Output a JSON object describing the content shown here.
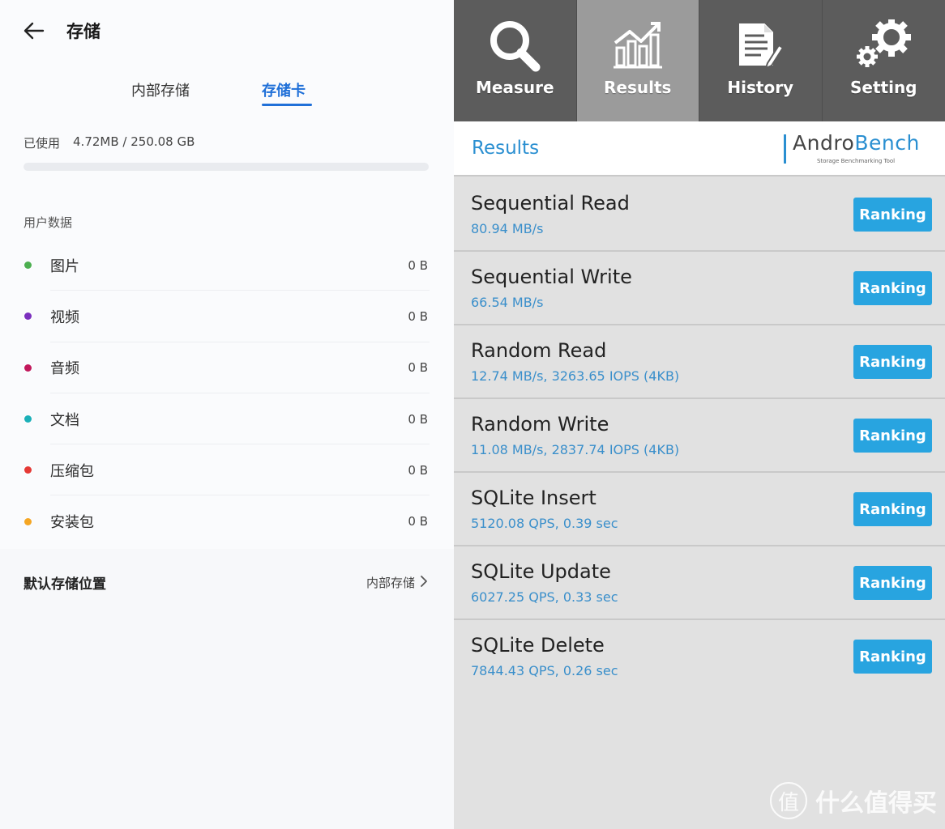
{
  "left": {
    "title": "存储",
    "tabs": [
      {
        "label": "内部存储",
        "active": false
      },
      {
        "label": "存储卡",
        "active": true
      }
    ],
    "usage": {
      "label": "已使用",
      "value": "4.72MB / 250.08 GB",
      "fraction": 2e-05
    },
    "section_label": "用户数据",
    "categories": [
      {
        "label": "图片",
        "size": "0 B",
        "color": "#4caf50"
      },
      {
        "label": "视频",
        "size": "0 B",
        "color": "#7b2fbe"
      },
      {
        "label": "音频",
        "size": "0 B",
        "color": "#c2185b"
      },
      {
        "label": "文档",
        "size": "0 B",
        "color": "#1ab0b8"
      },
      {
        "label": "压缩包",
        "size": "0 B",
        "color": "#e53935"
      },
      {
        "label": "安装包",
        "size": "0 B",
        "color": "#f5a623"
      }
    ],
    "default_location": {
      "label": "默认存储位置",
      "value": "内部存储"
    }
  },
  "right": {
    "toolbar": [
      {
        "label": "Measure",
        "icon": "search-icon",
        "active": false
      },
      {
        "label": "Results",
        "icon": "chart-icon",
        "active": true
      },
      {
        "label": "History",
        "icon": "history-icon",
        "active": false
      },
      {
        "label": "Setting",
        "icon": "gear-icon",
        "active": false
      }
    ],
    "results_title": "Results",
    "logo": {
      "prefix": "Andro",
      "suffix": "Bench",
      "tagline": "Storage Benchmarking Tool"
    },
    "ranking_label": "Ranking",
    "results": [
      {
        "name": "Sequential Read",
        "value": "80.94 MB/s"
      },
      {
        "name": "Sequential Write",
        "value": "66.54 MB/s"
      },
      {
        "name": "Random Read",
        "value": "12.74 MB/s, 3263.65 IOPS (4KB)"
      },
      {
        "name": "Random Write",
        "value": "11.08 MB/s, 2837.74 IOPS (4KB)"
      },
      {
        "name": "SQLite Insert",
        "value": "5120.08 QPS, 0.39 sec"
      },
      {
        "name": "SQLite Update",
        "value": "6027.25 QPS, 0.33 sec"
      },
      {
        "name": "SQLite Delete",
        "value": "7844.43 QPS, 0.26 sec"
      }
    ],
    "colors": {
      "accent": "#28a4e0",
      "toolbar": "#5c5c5c",
      "toolbar_active": "#9b9b9b"
    }
  },
  "watermark": {
    "glyph": "值",
    "text": "什么值得买"
  }
}
